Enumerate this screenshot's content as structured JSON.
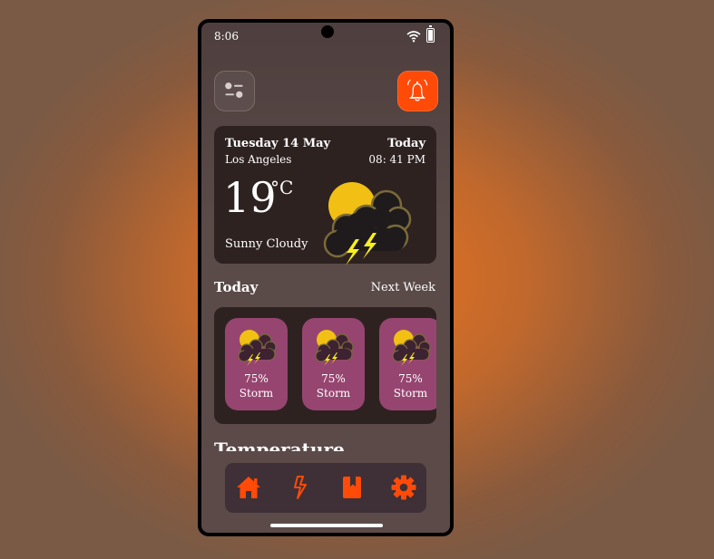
{
  "status_bar": {
    "time": "8:06"
  },
  "header": {
    "menu_icon": "settings-toggle-icon",
    "alarm_icon": "alarm-bell-icon"
  },
  "current": {
    "date": "Tuesday 14 May",
    "city": "Los Angeles",
    "day_label": "Today",
    "time": "08: 41 PM",
    "temperature": "19",
    "unit": "°C",
    "condition": "Sunny Cloudy",
    "icon": "sun-cloud-thunder-icon"
  },
  "sections": {
    "today": "Today",
    "next_week": "Next Week",
    "temperature": "Temperature"
  },
  "forecast": [
    {
      "percent": "75%",
      "label": "Storm",
      "icon": "sun-cloud-thunder-icon"
    },
    {
      "percent": "75%",
      "label": "Storm",
      "icon": "sun-cloud-thunder-icon"
    },
    {
      "percent": "75%",
      "label": "Storm",
      "icon": "sun-cloud-thunder-icon"
    }
  ],
  "navbar": [
    {
      "icon": "home-icon",
      "label": "Home"
    },
    {
      "icon": "lightning-icon",
      "label": "Storm"
    },
    {
      "icon": "bookmark-icon",
      "label": "Saved"
    },
    {
      "icon": "gear-icon",
      "label": "Settings"
    }
  ],
  "colors": {
    "accent": "#ff4a08",
    "card": "#2e2221",
    "forecast_card": "#964570",
    "sun": "#f2c014",
    "bolt": "#f7ef1f"
  }
}
